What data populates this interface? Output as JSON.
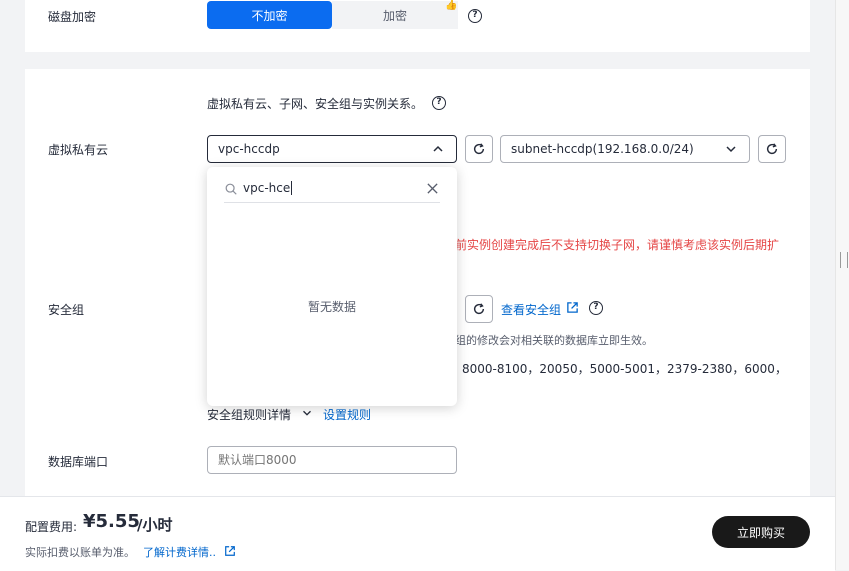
{
  "disk_encryption": {
    "label": "磁盘加密",
    "options": [
      "不加密",
      "加密"
    ],
    "selected": "不加密",
    "badge": "👍"
  },
  "vpc_section": {
    "description": "虚拟私有云、子网、安全组与实例关系。",
    "vpc_label": "虚拟私有云",
    "vpc_selected": "vpc-hccdp",
    "subnet_selected": "subnet-hccdp(192.168.0.0/24)",
    "warning": "前实例创建完成后不支持切换子网，请谨慎考虑该实例后期扩"
  },
  "dropdown": {
    "search_value": "vpc-hce",
    "empty_text": "暂无数据"
  },
  "security_group": {
    "label": "安全组",
    "view_link": "查看安全组",
    "note": "组的修改会对相关联的数据库立即生效。",
    "ports": "、8000-8100，20050，5000-5001，2379-2380，6000，",
    "rules_detail": "安全组规则详情",
    "set_rules": "设置规则"
  },
  "db_port": {
    "label": "数据库端口",
    "placeholder": "默认端口8000"
  },
  "footer": {
    "cost_label": "配置费用:",
    "price": "¥5.55",
    "unit": "/小时",
    "note": "实际扣费以账单为准。",
    "link": "了解计费详情..",
    "buy_button": "立即购买"
  },
  "colors": {
    "primary": "#0b6cf0",
    "link": "#0066cc",
    "warning": "#e54545",
    "buy": "#191919"
  }
}
